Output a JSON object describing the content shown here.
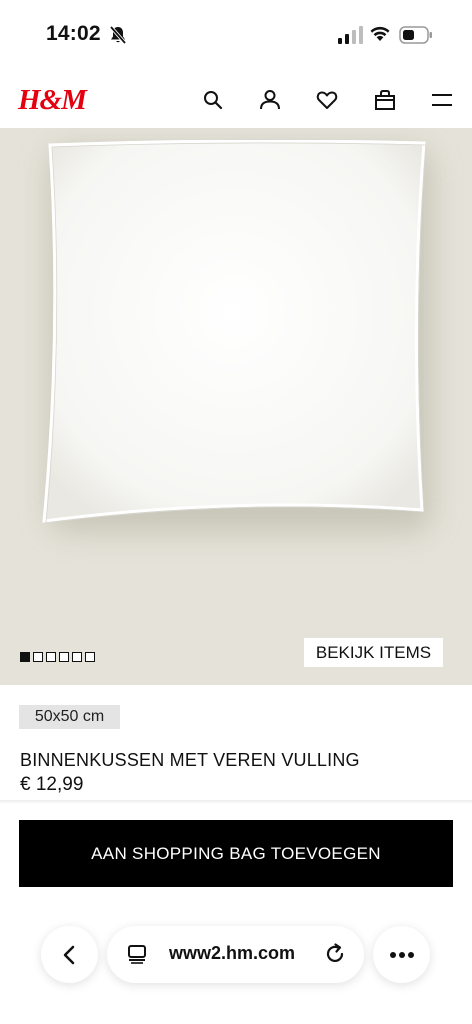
{
  "status_bar": {
    "time": "14:02",
    "icons": [
      "bell-slash-icon",
      "signal-icon",
      "wifi-icon",
      "battery-icon"
    ]
  },
  "header": {
    "logo": "H&M",
    "icons": [
      "search-icon",
      "account-icon",
      "heart-icon",
      "bag-icon",
      "menu-icon"
    ],
    "brand_color": "#e50010"
  },
  "product": {
    "image_dots": {
      "count": 6,
      "active_index": 0
    },
    "view_items_label": "BEKIJK ITEMS",
    "size": "50x50 cm",
    "title": "BINNENKUSSEN MET VEREN VULLING",
    "price": "€ 12,99",
    "add_to_bag_label": "AAN SHOPPING BAG TOEVOEGEN"
  },
  "browser": {
    "url": "www2.hm.com",
    "icons": [
      "back-chevron-icon",
      "tabs-icon",
      "reload-icon",
      "more-dots-icon"
    ]
  }
}
